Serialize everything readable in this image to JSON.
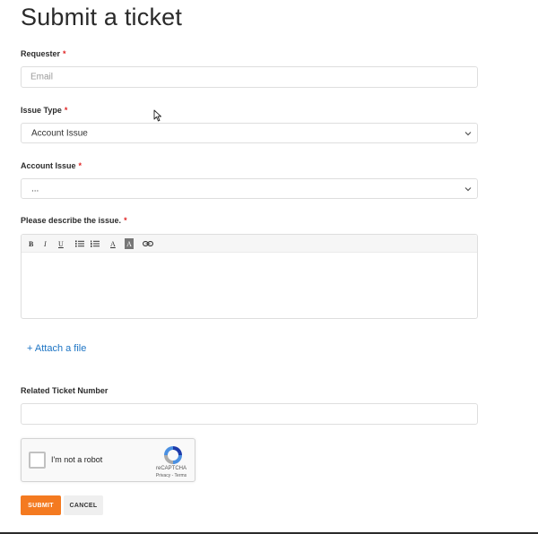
{
  "page": {
    "title": "Submit a ticket"
  },
  "requester": {
    "label": "Requester",
    "required_mark": "*",
    "placeholder": "Email",
    "value": ""
  },
  "issue_type": {
    "label": "Issue Type",
    "required_mark": "*",
    "selected": "Account Issue"
  },
  "account_issue": {
    "label": "Account Issue",
    "required_mark": "*",
    "selected": "..."
  },
  "description": {
    "label": "Please describe the issue.",
    "required_mark": "*",
    "toolbar": {
      "bold": "B",
      "italic": "I",
      "underline": "U",
      "font_color": "A",
      "highlight": "A"
    },
    "value": ""
  },
  "attach": {
    "label": "+ Attach a file"
  },
  "related_ticket": {
    "label": "Related Ticket Number",
    "value": ""
  },
  "recaptcha": {
    "label": "I'm not a robot",
    "brand": "reCAPTCHA",
    "terms": "Privacy - Terms"
  },
  "actions": {
    "submit_label": "SUBMIT",
    "cancel_label": "CANCEL"
  },
  "colors": {
    "accent": "#f47a20",
    "link": "#1c74c4",
    "required": "#e02424"
  }
}
